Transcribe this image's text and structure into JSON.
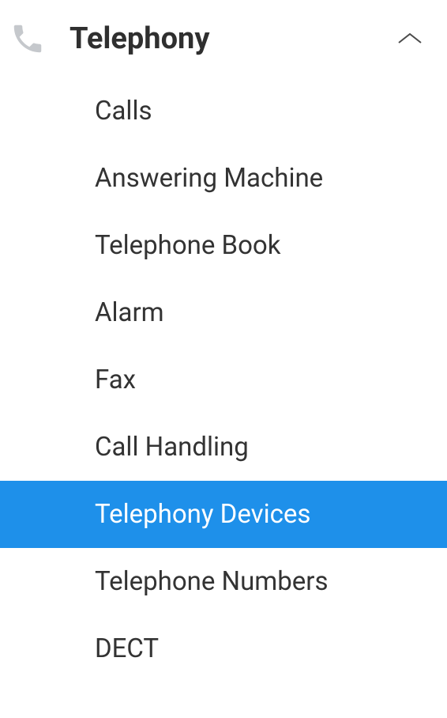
{
  "nav": {
    "title": "Telephony",
    "items": [
      {
        "label": "Calls",
        "active": false
      },
      {
        "label": "Answering Machine",
        "active": false
      },
      {
        "label": "Telephone Book",
        "active": false
      },
      {
        "label": "Alarm",
        "active": false
      },
      {
        "label": "Fax",
        "active": false
      },
      {
        "label": "Call Handling",
        "active": false
      },
      {
        "label": "Telephony Devices",
        "active": true
      },
      {
        "label": "Telephone Numbers",
        "active": false
      },
      {
        "label": "DECT",
        "active": false
      }
    ]
  }
}
